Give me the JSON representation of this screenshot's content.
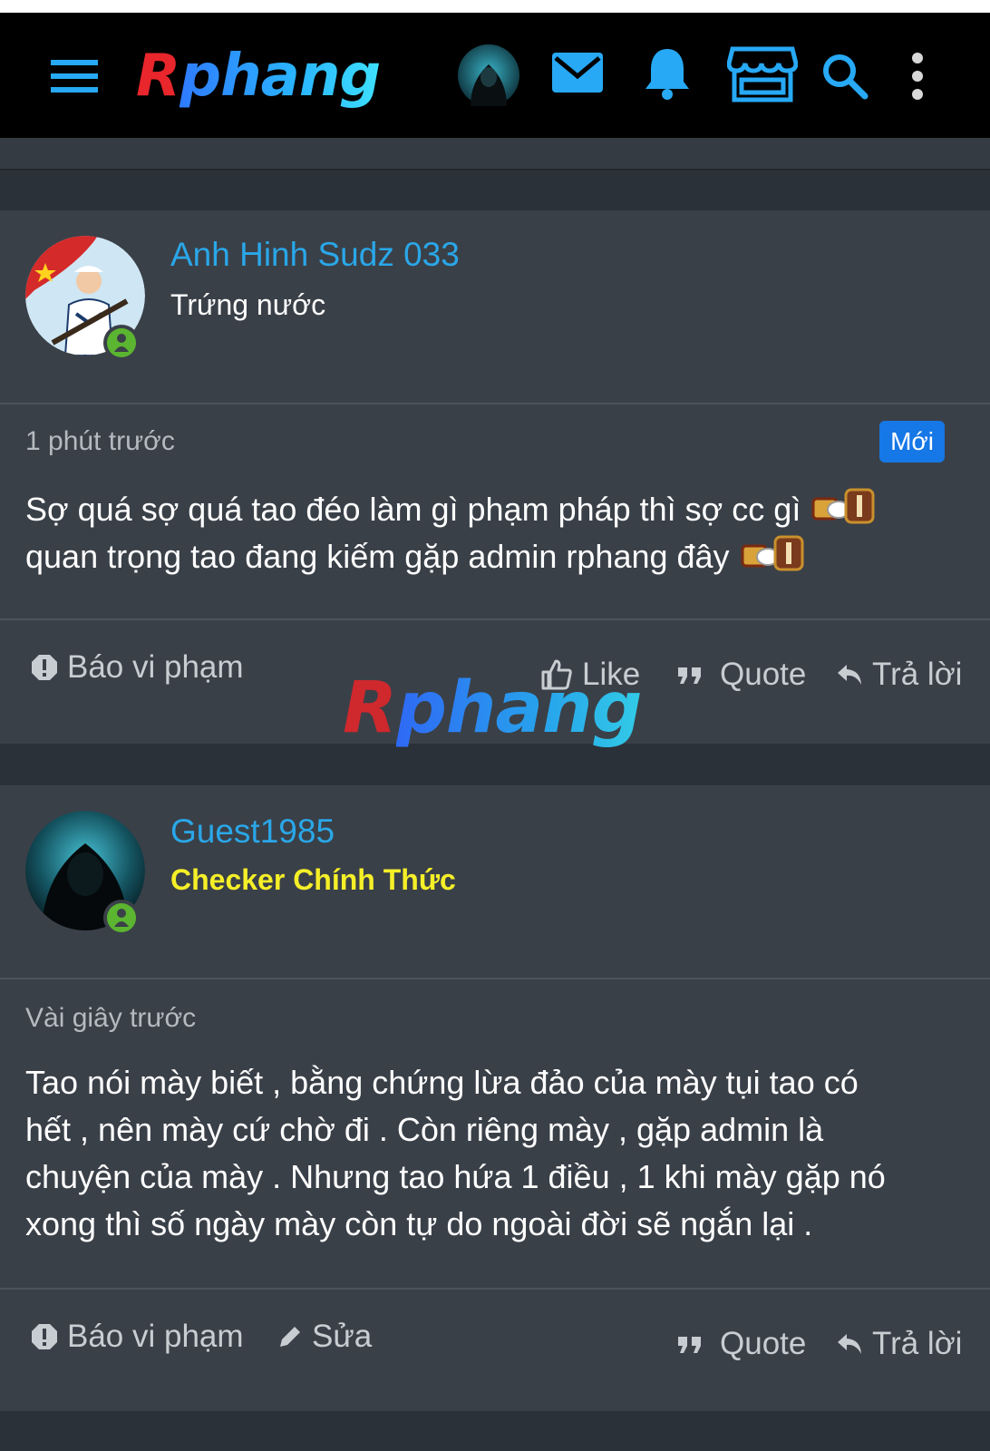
{
  "header": {
    "logo_first": "R",
    "logo_rest": "phang",
    "accent": "#27a9f5",
    "icons": [
      "menu-icon",
      "avatar",
      "mail-icon",
      "bell-icon",
      "store-icon",
      "search-icon",
      "more-vertical-icon"
    ]
  },
  "watermark": {
    "first": "R",
    "rest": "phang"
  },
  "posts": [
    {
      "username": "Anh Hinh Sudz 033",
      "user_title": "Trứng nước",
      "time": "1 phút trước",
      "badge": "Mới",
      "line1": "Sợ quá sợ quá tao đéo làm gì phạm pháp thì sợ cc gì",
      "line2": "quan trọng tao đang kiếm gặp admin rphang đây",
      "actions": {
        "report": "Báo vi phạm",
        "like": "Like",
        "quote": "Quote",
        "reply": "Trả lời"
      }
    },
    {
      "username": "Guest1985",
      "user_title": "Checker Chính Thức",
      "time": "Vài giây trước",
      "line1": "Tao nói mày biết , bằng chứng lừa đảo của mày tụi tao có",
      "line2": "hết , nên mày cứ chờ đi . Còn riêng mày , gặp admin là",
      "line3": "chuyện của mày . Nhưng tao hứa 1 điều , 1 khi mày gặp nó",
      "line4": "xong thì số ngày mày còn tự do ngoài đời sẽ ngắn lại .",
      "actions": {
        "report": "Báo vi phạm",
        "edit": "Sửa",
        "quote": "Quote",
        "reply": "Trả lời"
      }
    }
  ],
  "colors": {
    "username": "#2aa7e8",
    "online": "#5bb530",
    "badge": "#1677e6",
    "checker_title": "#f5ef28"
  }
}
